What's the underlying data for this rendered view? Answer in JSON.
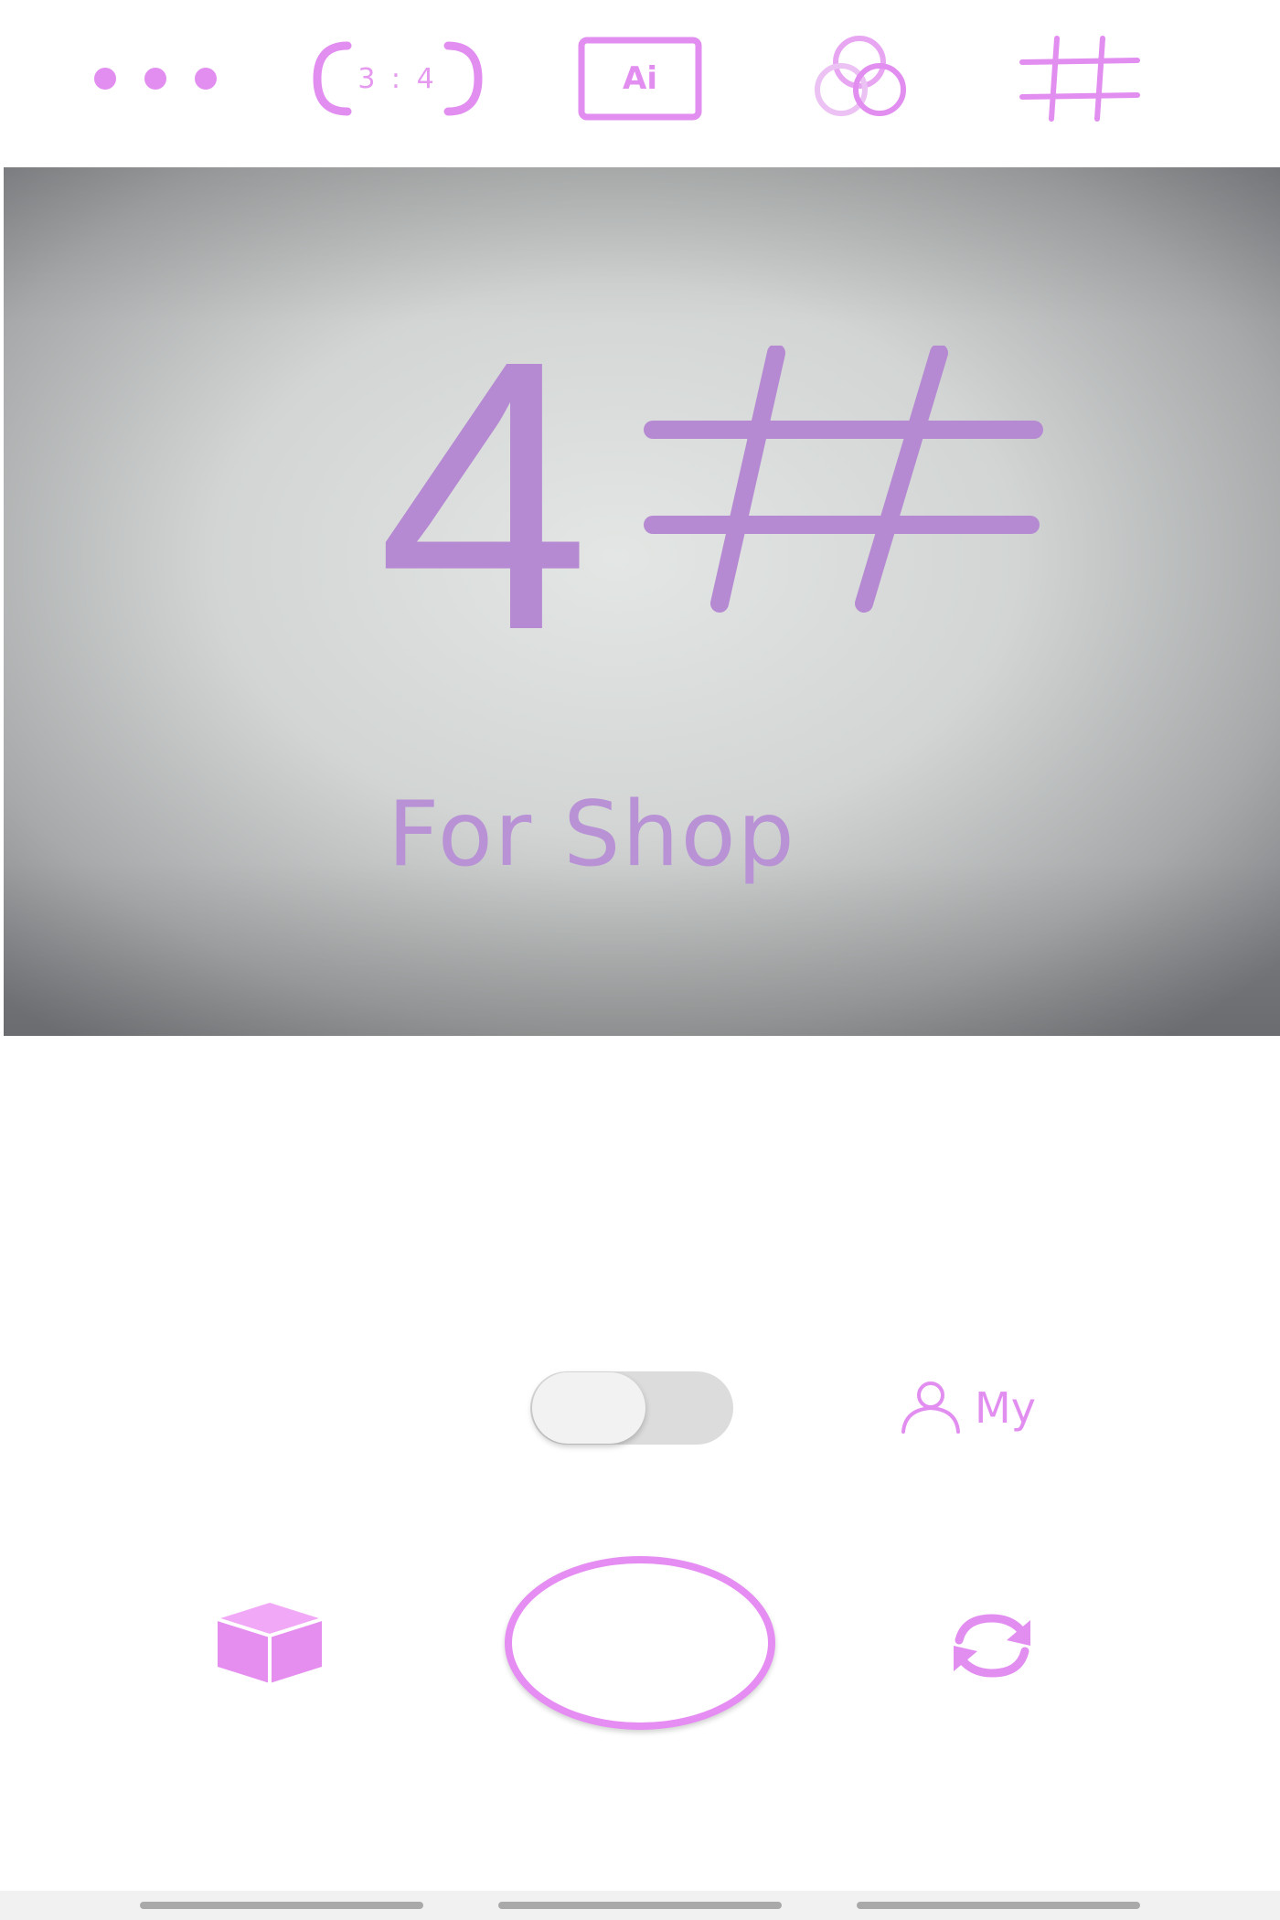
{
  "toolbar": {
    "more_icon": "more-dots-icon",
    "aspect_ratio": "3 : 4",
    "ai_label": "Ai",
    "filter_icon": "filter-circles-icon",
    "grid_icon": "grid-hash-icon"
  },
  "preview": {
    "main_text": "4",
    "sub_text": "For Shop"
  },
  "controls": {
    "mode_toggle_on": false,
    "my_label": "My",
    "profile_icon": "person-icon",
    "box_icon": "cube-icon",
    "switch_camera_icon": "switch-camera-icon"
  },
  "colors": {
    "accent": "#e28ef0",
    "preview_text": "#b58ad2",
    "toggle_track": "#dcdcdc"
  }
}
